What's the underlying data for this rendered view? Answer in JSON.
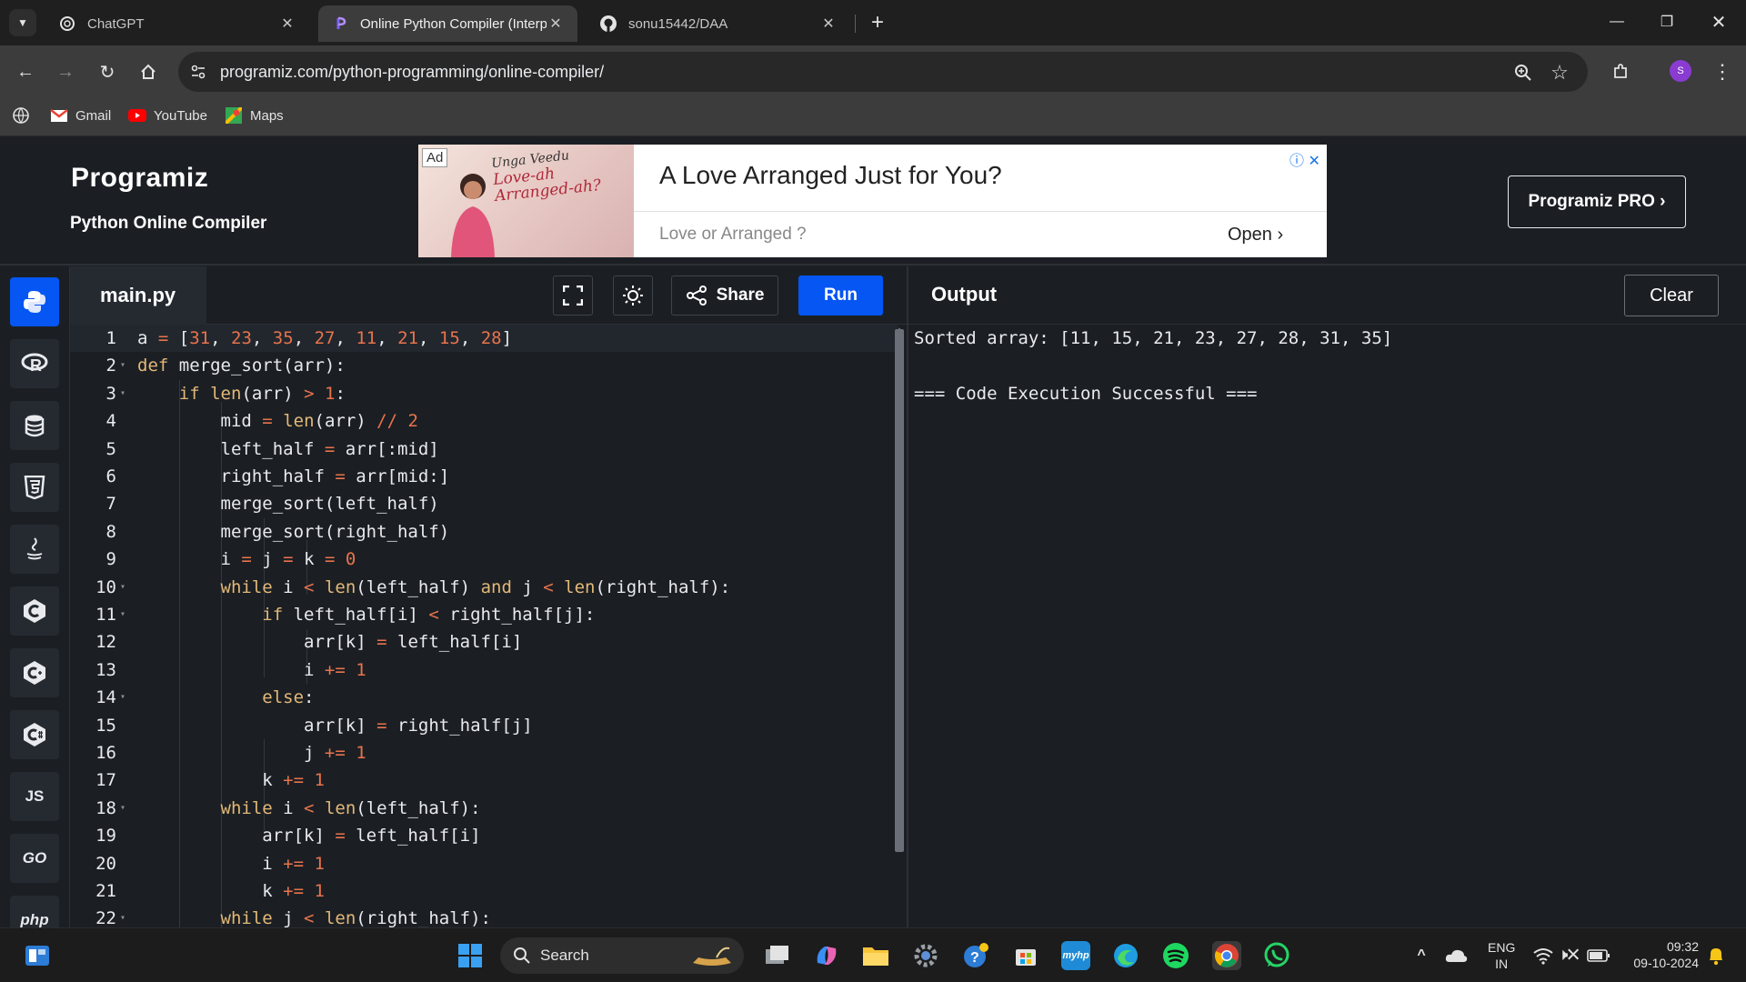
{
  "browser": {
    "tabs": [
      {
        "title": "ChatGPT",
        "active": false
      },
      {
        "title": "Online Python Compiler (Interp",
        "active": true
      },
      {
        "title": "sonu15442/DAA",
        "active": false
      }
    ],
    "new_tab": "+",
    "url": "programiz.com/python-programming/online-compiler/",
    "bookmarks": [
      "Gmail",
      "YouTube",
      "Maps"
    ],
    "profile_initial": "S"
  },
  "header": {
    "logo": "Programiz",
    "subtitle": "Python Online Compiler",
    "pro_button": "Programiz PRO ›"
  },
  "ad": {
    "tag": "Ad",
    "script_line1": "Unga Veedu",
    "script_line2": "Love-ah",
    "script_line3": "Arranged-ah?",
    "title": "A Love Arranged Just for You?",
    "subtitle": "Love or Arranged ?",
    "cta": "Open ›"
  },
  "sidebar": {
    "languages": [
      "python",
      "r",
      "sql",
      "html",
      "java",
      "c",
      "cpp",
      "csharp",
      "JS",
      "GO",
      "php"
    ]
  },
  "editor": {
    "filename": "main.py",
    "share_label": "Share",
    "run_label": "Run"
  },
  "output": {
    "title": "Output",
    "clear_label": "Clear",
    "lines": [
      "Sorted array: [11, 15, 21, 23, 27, 28, 31, 35]",
      "",
      "=== Code Execution Successful ==="
    ]
  },
  "taskbar": {
    "search_placeholder": "Search",
    "lang_line1": "ENG",
    "lang_line2": "IN",
    "time": "09:32",
    "date": "09-10-2024"
  },
  "colors": {
    "accent": "#0556f3",
    "keyword": "#e3b877",
    "number": "#e8734c",
    "editor_bg": "#1b1f24"
  }
}
